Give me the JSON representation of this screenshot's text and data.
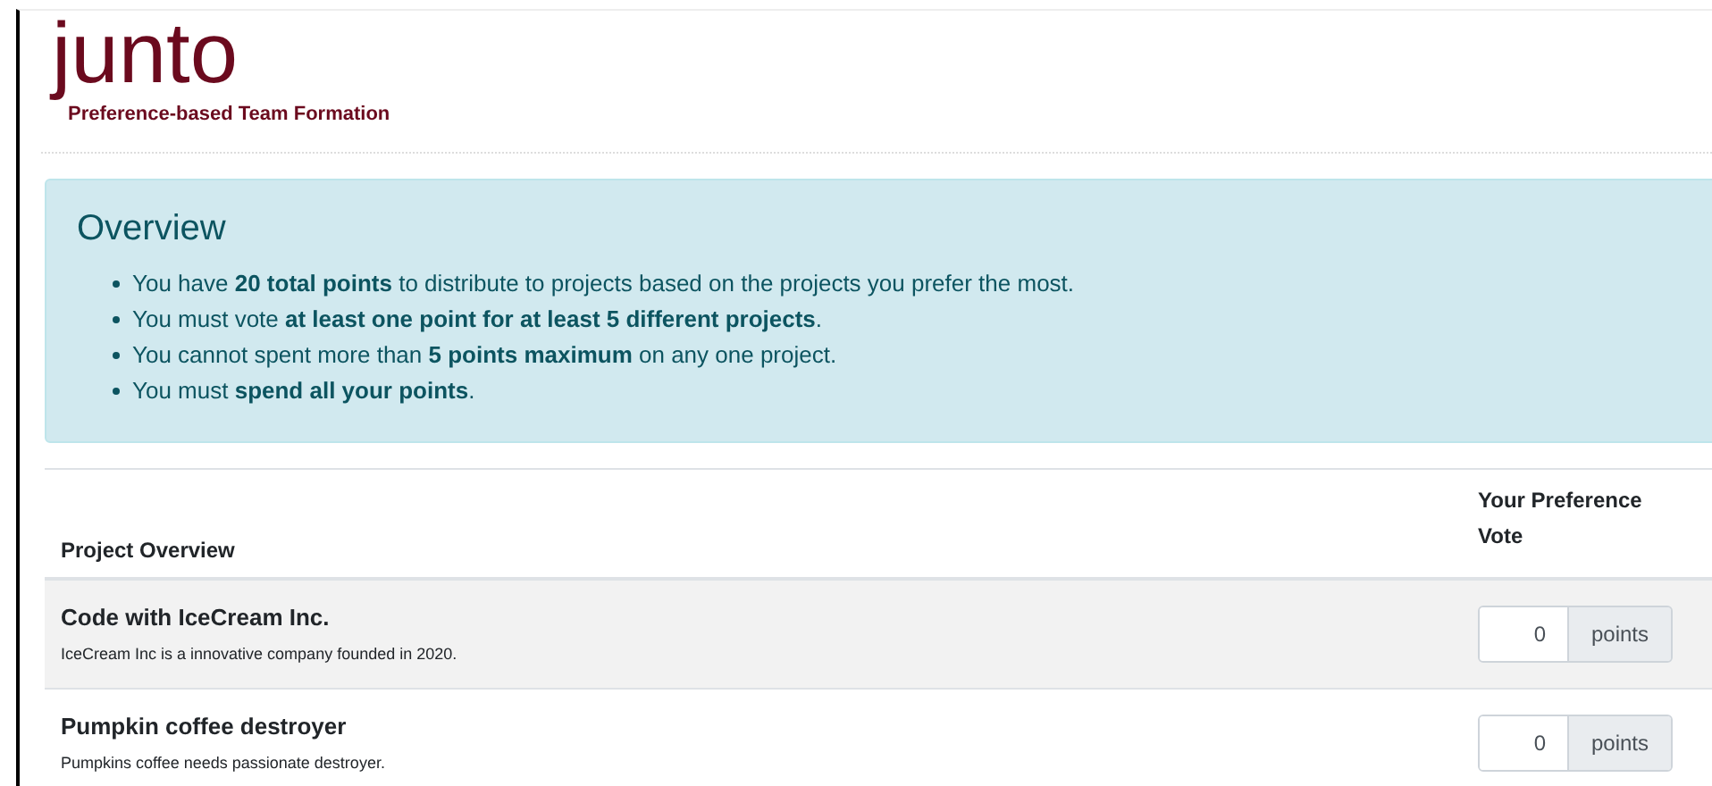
{
  "header": {
    "logo": "junto",
    "tagline": "Preference-based Team Formation"
  },
  "overview": {
    "title": "Overview",
    "rules": [
      "You have **20 total points** to distribute to projects based on the projects you prefer the most.",
      "You must vote **at least one point for at least 5 different projects**.",
      "You cannot spent more than **5 points maximum** on any one project.",
      "You must **spend all your points**."
    ]
  },
  "table": {
    "columns": [
      "Project Overview",
      "Your Preference Vote"
    ],
    "rows": [
      {
        "title": "Code with IceCream Inc.",
        "description": "IceCream Inc is a innovative company founded in 2020.",
        "vote": "0",
        "unit": "points"
      },
      {
        "title": "Pumpkin coffee destroyer",
        "description": "Pumpkins coffee needs passionate destroyer.",
        "vote": "0",
        "unit": "points"
      }
    ]
  }
}
